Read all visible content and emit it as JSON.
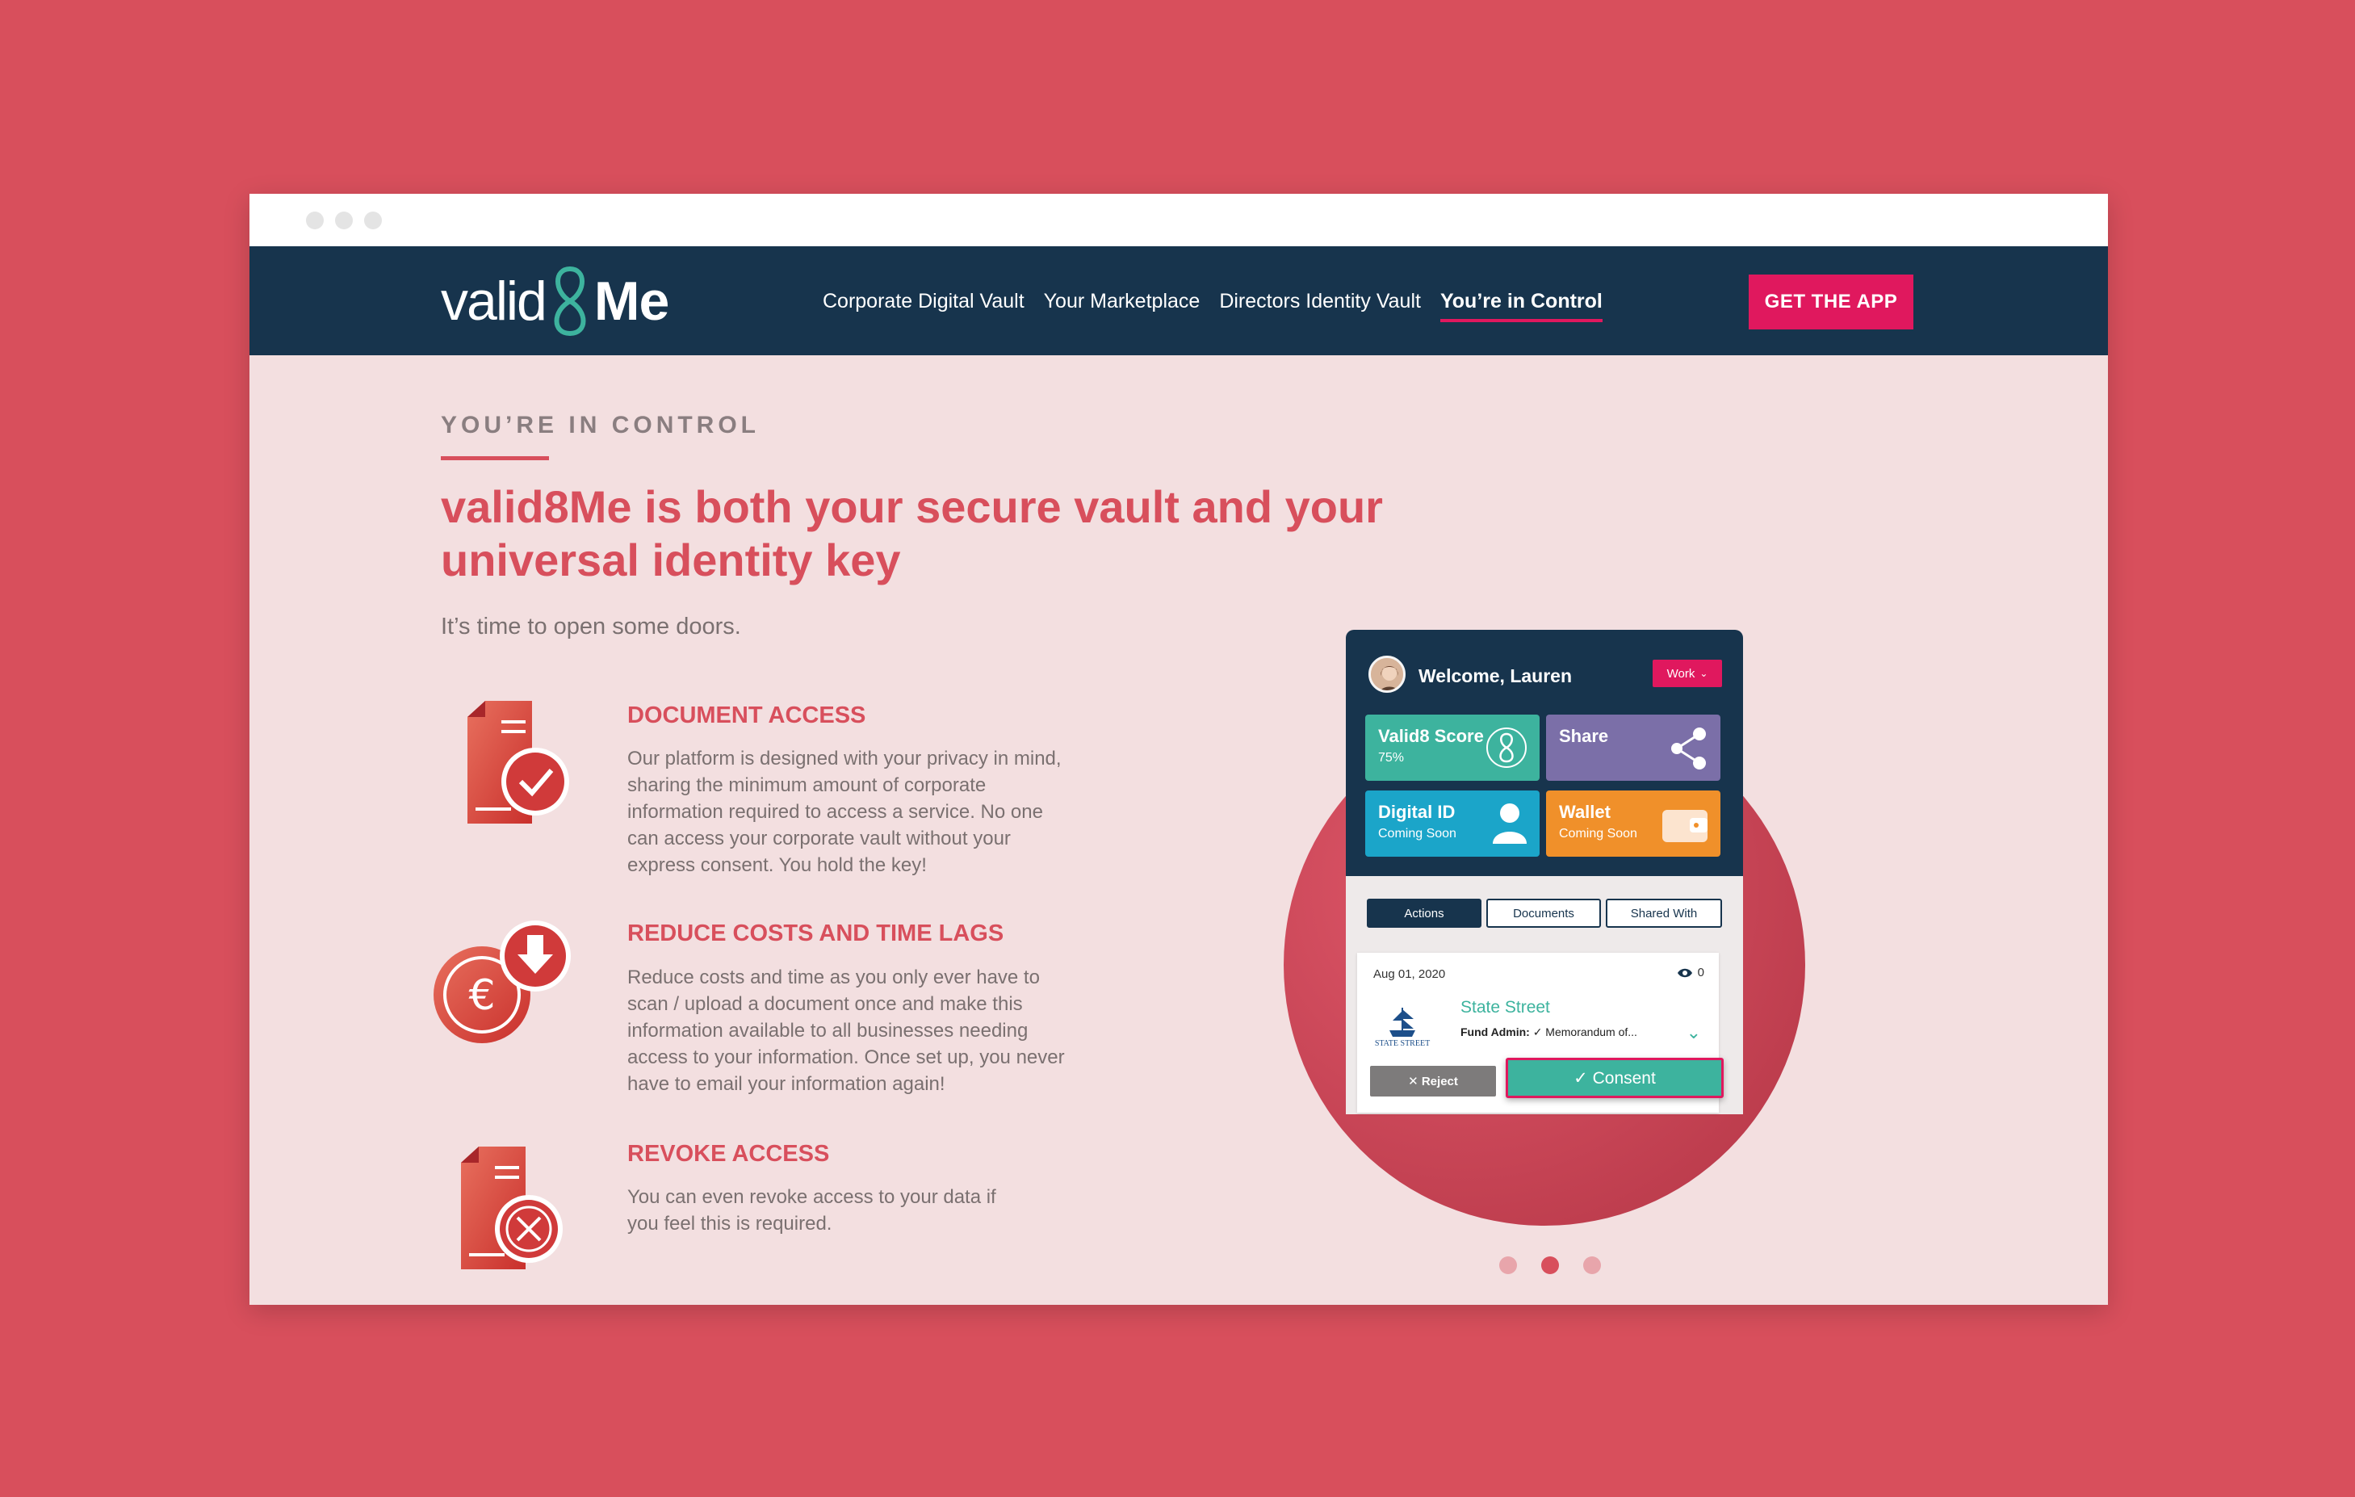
{
  "brand": {
    "logo_part1": "valid",
    "logo_part2": "Me"
  },
  "nav": {
    "items": [
      {
        "label": "Corporate Digital Vault",
        "active": false
      },
      {
        "label": "Your Marketplace",
        "active": false
      },
      {
        "label": "Directors Identity Vault",
        "active": false
      },
      {
        "label": "You’re in Control",
        "active": true
      }
    ],
    "cta": "GET THE APP"
  },
  "hero": {
    "eyebrow": "YOU’RE IN CONTROL",
    "headline": "valid8Me is both your secure vault and your universal identity key",
    "subline": "It’s time to open some doors."
  },
  "features": [
    {
      "title": "DOCUMENT ACCESS",
      "body": "Our platform is designed with your privacy in mind, sharing the minimum amount of corporate information required to access a service. No one can access your corporate vault without your express consent. You hold the key!",
      "icon": "document-check-icon"
    },
    {
      "title": "REDUCE COSTS AND TIME LAGS",
      "body": "Reduce costs and time as you only ever have to scan / upload a document once and make this information available to all businesses needing access to your information. Once set up, you never have to email your information again!",
      "icon": "euro-download-icon"
    },
    {
      "title": "REVOKE ACCESS",
      "body": "You can even revoke access to your data if you feel this is required.",
      "icon": "document-x-icon"
    }
  ],
  "app": {
    "welcome": "Welcome, Lauren",
    "profile_select": "Work",
    "tiles": [
      {
        "title": "Valid8 Score",
        "sub": "75%",
        "color": "#3db39e",
        "icon": "score-icon"
      },
      {
        "title": "Share",
        "sub": "",
        "color": "#7b6fa8",
        "icon": "share-icon"
      },
      {
        "title": "Digital ID",
        "sub": "Coming Soon",
        "color": "#1ba5c9",
        "icon": "person-icon"
      },
      {
        "title": "Wallet",
        "sub": "Coming Soon",
        "color": "#f0902a",
        "icon": "wallet-icon"
      }
    ],
    "tabs": [
      {
        "label": "Actions",
        "active": true
      },
      {
        "label": "Documents",
        "active": false
      },
      {
        "label": "Shared With",
        "active": false
      }
    ],
    "card": {
      "date": "Aug 01, 2020",
      "views": "0",
      "company": "State Street",
      "logo_text": "STATE STREET",
      "fund_label": "Fund Admin:",
      "fund_value": "✓ Memorandum of...",
      "reject": "✕ Reject",
      "consent": "✓ Consent"
    }
  },
  "carousel": {
    "count": 3,
    "active_index": 1
  },
  "colors": {
    "background": "#d84f5c",
    "nav": "#17344d",
    "accent": "#e0185e",
    "heading": "#d84f5c",
    "page": "#f3dfe0"
  }
}
